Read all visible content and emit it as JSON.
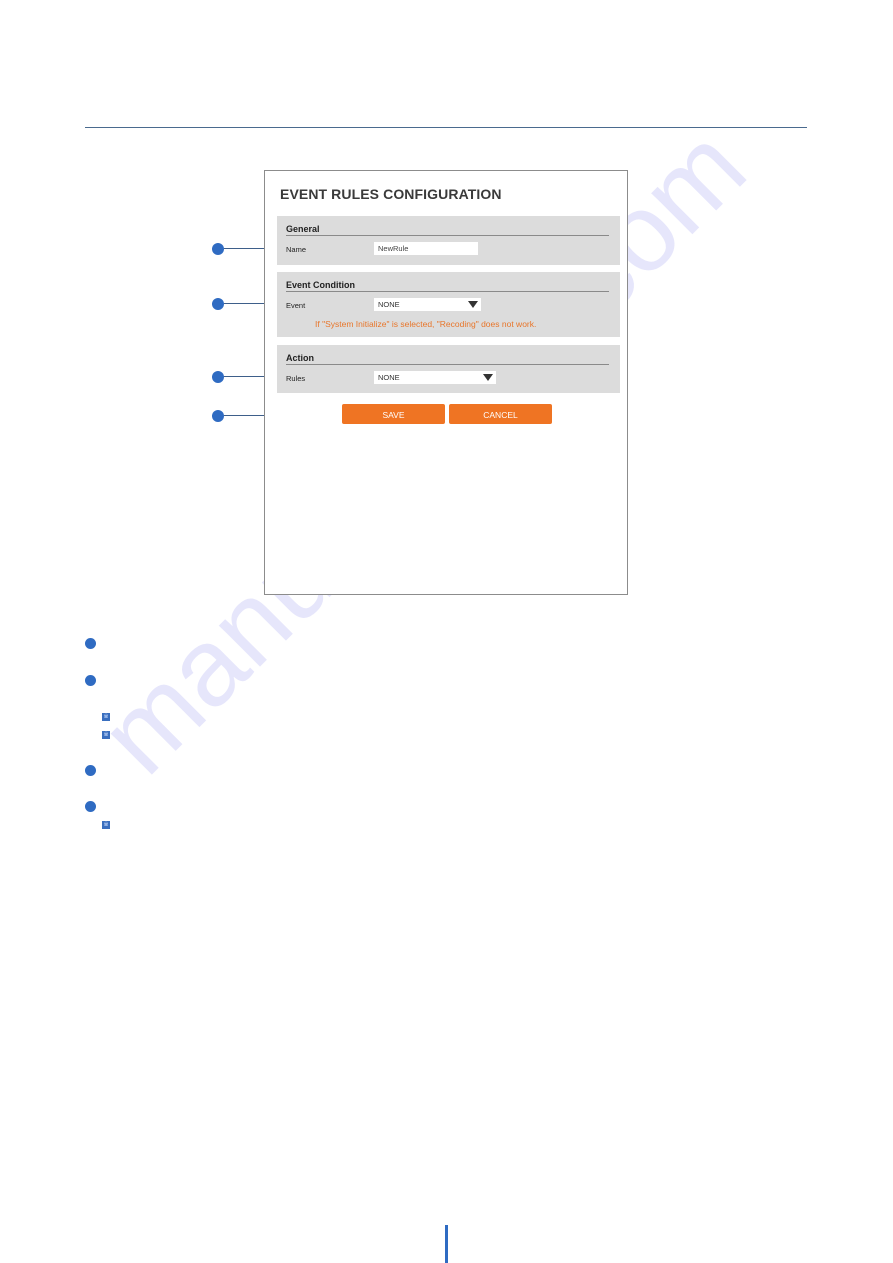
{
  "screen": {
    "title": "EVENT RULES CONFIGURATION",
    "sections": {
      "general": {
        "heading": "General",
        "name_label": "Name",
        "name_value": "NewRule"
      },
      "event_condition": {
        "heading": "Event Condition",
        "event_label": "Event",
        "event_selected": "NONE",
        "warning": "If \"System Initialize\" is selected, \"Recoding\" does not work."
      },
      "action": {
        "heading": "Action",
        "rules_label": "Rules",
        "rules_selected": "NONE"
      }
    },
    "buttons": {
      "save": "SAVE",
      "cancel": "CANCEL"
    }
  },
  "callouts": [
    "name-field",
    "event-field",
    "rules-field",
    "save-button"
  ],
  "colors": {
    "accent_blue": "#2f6bc2",
    "button_orange": "#ef7423",
    "warning_orange": "#e8762b",
    "section_gray": "#dcdcdc"
  },
  "watermark": "manualshive.com"
}
